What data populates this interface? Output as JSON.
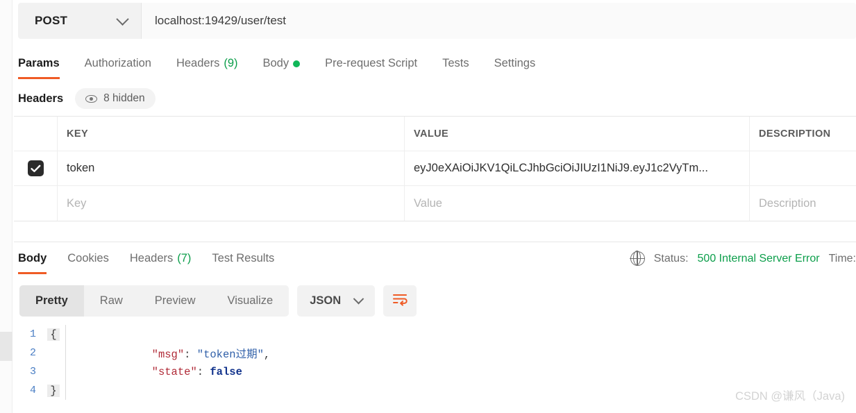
{
  "request": {
    "method": "POST",
    "method_icon": "chevron-down-icon",
    "url": "localhost:19429/user/test",
    "tabs": [
      {
        "label": "Params",
        "count": "",
        "active": false
      },
      {
        "label": "Authorization",
        "count": "",
        "active": false
      },
      {
        "label": "Headers",
        "count": "(9)",
        "active": true
      },
      {
        "label": "Body",
        "count": "",
        "active": false,
        "dot": true
      },
      {
        "label": "Pre-request Script",
        "count": "",
        "active": false
      },
      {
        "label": "Tests",
        "count": "",
        "active": false
      },
      {
        "label": "Settings",
        "count": "",
        "active": false
      }
    ],
    "headers_section": {
      "title": "Headers",
      "hidden_pill": {
        "icon": "eye-icon",
        "label": "8 hidden"
      },
      "columns": [
        "KEY",
        "VALUE",
        "DESCRIPTION"
      ],
      "rows": [
        {
          "checked": true,
          "key": "token",
          "value": "eyJ0eXAiOiJKV1QiLCJhbGciOiJIUzI1NiJ9.eyJ1c2VyTm...",
          "description": ""
        }
      ],
      "placeholder_row": {
        "key": "Key",
        "value": "Value",
        "description": "Description"
      }
    }
  },
  "response": {
    "tabs": [
      {
        "label": "Body",
        "count": "",
        "active": true
      },
      {
        "label": "Cookies",
        "count": "",
        "active": false
      },
      {
        "label": "Headers",
        "count": "(7)",
        "active": false
      },
      {
        "label": "Test Results",
        "count": "",
        "active": false
      }
    ],
    "meta": {
      "globe_icon": "globe-icon",
      "status_label": "Status:",
      "status_value": "500 Internal Server Error",
      "time_label": "Time:"
    },
    "toolbar": {
      "views": [
        {
          "label": "Pretty",
          "active": true
        },
        {
          "label": "Raw",
          "active": false
        },
        {
          "label": "Preview",
          "active": false
        },
        {
          "label": "Visualize",
          "active": false
        }
      ],
      "format": "JSON",
      "format_icon": "chevron-down-icon",
      "wrap_icon": "wrap-lines-icon"
    },
    "body_lines": [
      {
        "n": "1",
        "fold": "{",
        "segments": []
      },
      {
        "n": "2",
        "fold": "",
        "segments": [
          {
            "t": "    ",
            "c": "k-punc"
          },
          {
            "t": "\"msg\"",
            "c": "k-key"
          },
          {
            "t": ": ",
            "c": "k-punc"
          },
          {
            "t": "\"token过期\"",
            "c": "k-str"
          },
          {
            "t": ",",
            "c": "k-punc"
          }
        ]
      },
      {
        "n": "3",
        "fold": "",
        "segments": [
          {
            "t": "    ",
            "c": "k-punc"
          },
          {
            "t": "\"state\"",
            "c": "k-key"
          },
          {
            "t": ": ",
            "c": "k-punc"
          },
          {
            "t": "false",
            "c": "k-bool"
          }
        ]
      },
      {
        "n": "4",
        "fold": "}",
        "segments": []
      }
    ]
  },
  "watermark": "CSDN @谦风（Java)",
  "colors": {
    "accent_orange": "#ef5b25",
    "success_green": "#0b9e4a",
    "body_dot_green": "#10b759",
    "checkbox_dark": "#2b2b2b"
  }
}
